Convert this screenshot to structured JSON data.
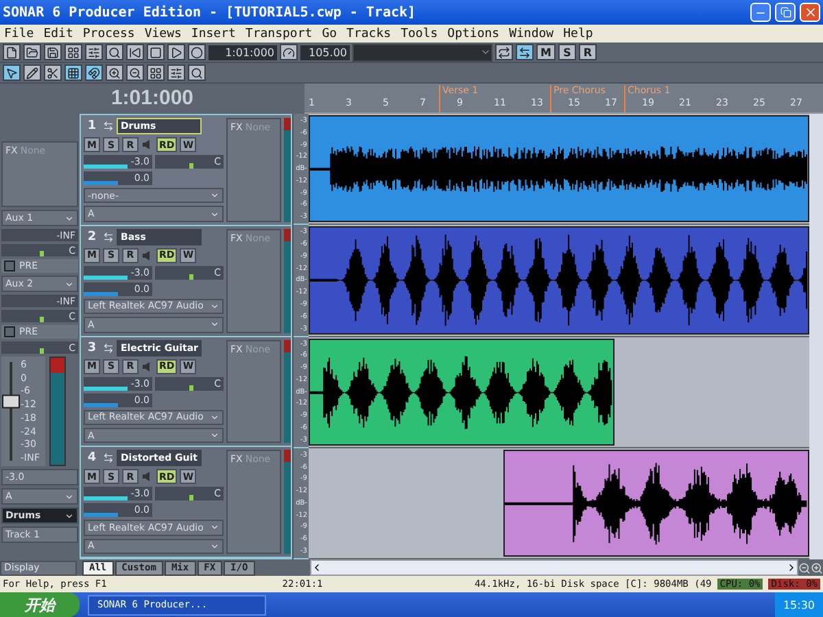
{
  "window": {
    "title": "SONAR 6 Producer Edition - [TUTORIAL5.cwp - Track]"
  },
  "menu": [
    "File",
    "Edit",
    "Process",
    "Views",
    "Insert",
    "Transport",
    "Go",
    "Tracks",
    "Tools",
    "Options",
    "Window",
    "Help"
  ],
  "transport": {
    "time": "1:01:000",
    "tempo": "105.00"
  },
  "toolbar_buttons": [
    {
      "label": "M"
    },
    {
      "label": "S"
    },
    {
      "label": "R"
    }
  ],
  "now_time": "1:01:000",
  "ruler": {
    "numbers": [
      "1",
      "3",
      "5",
      "7",
      "9",
      "11",
      "13",
      "15",
      "17",
      "19",
      "21",
      "23",
      "25",
      "27"
    ],
    "markers": [
      {
        "label": "Verse 1"
      },
      {
        "label": "Pre Chorus"
      },
      {
        "label": "Chorus 1"
      }
    ]
  },
  "inspector": {
    "fx_label": "FX",
    "fx_value": "None",
    "sends": [
      {
        "name": "Aux 1",
        "level_reading": "-INF",
        "send_level": {
          "level": 0
        },
        "pan": "C",
        "pan_level": {
          "level": 0.5
        },
        "pre": "PRE",
        "pre_checked": false
      },
      {
        "name": "Aux 2",
        "level_reading": "-INF",
        "send_level": {
          "level": 0
        },
        "pan": "C",
        "pan_level": {
          "level": 0.5
        },
        "pre": "PRE",
        "pre_checked": false
      }
    ],
    "pan": "C",
    "pan_level": {
      "level": 0.5
    },
    "fader_scale": [
      "6",
      "0",
      "-6",
      "-12",
      "-18",
      "-24",
      "-30",
      "-INF"
    ],
    "fader": {
      "level": 0.62
    },
    "volume": "-3.0",
    "output": "A",
    "track_name": "Drums",
    "track_number": "Track 1",
    "display": "Display"
  },
  "tracks": [
    {
      "number": "1",
      "name": "Drums",
      "selected": true,
      "buttons": [
        {
          "label": "M",
          "on": false
        },
        {
          "label": "S",
          "on": false
        },
        {
          "label": "R",
          "on": false
        },
        {
          "label": "RD",
          "on": true
        },
        {
          "label": "W",
          "on": false
        }
      ],
      "volume": {
        "reading": "-3.0",
        "level": 0.64
      },
      "pan": {
        "reading": "C",
        "level": 0.5
      },
      "trim": {
        "reading": "0.0",
        "level": 0.5
      },
      "input": "-none-",
      "output": "A",
      "fx_label": "FX",
      "fx_value": "None",
      "scale": [
        "-3",
        "-6",
        "-9",
        "-12",
        "dB-",
        "-12",
        "-9",
        "-6",
        "-3"
      ],
      "clip": {
        "color": "#2e8fe0"
      }
    },
    {
      "number": "2",
      "name": "Bass",
      "selected": false,
      "buttons": [
        {
          "label": "M",
          "on": false
        },
        {
          "label": "S",
          "on": false
        },
        {
          "label": "R",
          "on": false
        },
        {
          "label": "RD",
          "on": true
        },
        {
          "label": "W",
          "on": false
        }
      ],
      "volume": {
        "reading": "-3.0",
        "level": 0.64
      },
      "pan": {
        "reading": "C",
        "level": 0.5
      },
      "trim": {
        "reading": "0.0",
        "level": 0.5
      },
      "input": "Left Realtek AC97 Audio",
      "output": "A",
      "fx_label": "FX",
      "fx_value": "None",
      "scale": [
        "-3",
        "-6",
        "-9",
        "-12",
        "dB-",
        "-12",
        "-9",
        "-6",
        "-3"
      ],
      "clip": {
        "color": "#3a4fc4"
      }
    },
    {
      "number": "3",
      "name": "Electric Guitar",
      "selected": false,
      "buttons": [
        {
          "label": "M",
          "on": false
        },
        {
          "label": "S",
          "on": false
        },
        {
          "label": "R",
          "on": false
        },
        {
          "label": "RD",
          "on": true
        },
        {
          "label": "W",
          "on": false
        }
      ],
      "volume": {
        "reading": "-3.0",
        "level": 0.64
      },
      "pan": {
        "reading": "C",
        "level": 0.5
      },
      "trim": {
        "reading": "0.0",
        "level": 0.5
      },
      "input": "Left Realtek AC97 Audio",
      "output": "A",
      "fx_label": "FX",
      "fx_value": "None",
      "scale": [
        "-3",
        "-6",
        "-9",
        "-12",
        "dB-",
        "-12",
        "-9",
        "-6",
        "-3"
      ],
      "clip": {
        "color": "#2ebf74"
      }
    },
    {
      "number": "4",
      "name": "Distorted Guit",
      "selected": false,
      "buttons": [
        {
          "label": "M",
          "on": false
        },
        {
          "label": "S",
          "on": false
        },
        {
          "label": "R",
          "on": false
        },
        {
          "label": "RD",
          "on": true
        },
        {
          "label": "W",
          "on": false
        }
      ],
      "volume": {
        "reading": "-3.0",
        "level": 0.64
      },
      "pan": {
        "reading": "C",
        "level": 0.5
      },
      "trim": {
        "reading": "0.0",
        "level": 0.5
      },
      "input": "Left Realtek AC97 Audio",
      "output": "A",
      "fx_label": "FX",
      "fx_value": "None",
      "scale": [
        "-3",
        "-6",
        "-9",
        "-12",
        "dB-",
        "-12",
        "-9",
        "-6",
        "-3"
      ],
      "clip": {
        "color": "#c586d6"
      }
    }
  ],
  "view_tabs": [
    {
      "label": "All",
      "selected": true
    },
    {
      "label": "Custom",
      "selected": false
    },
    {
      "label": "Mix",
      "selected": false
    },
    {
      "label": "FX",
      "selected": false
    },
    {
      "label": "I/O",
      "selected": false
    }
  ],
  "status_bar": {
    "help": "For Help, press F1",
    "position": "22:01:1",
    "info": "44.1kHz, 16-bi Disk space [C]: 9804MB (49",
    "cpu": "CPU: 0%",
    "disk": "Disk: 0%"
  },
  "taskbar": {
    "start": "开始",
    "task": "SONAR 6 Producer...",
    "clock": "15:30"
  }
}
